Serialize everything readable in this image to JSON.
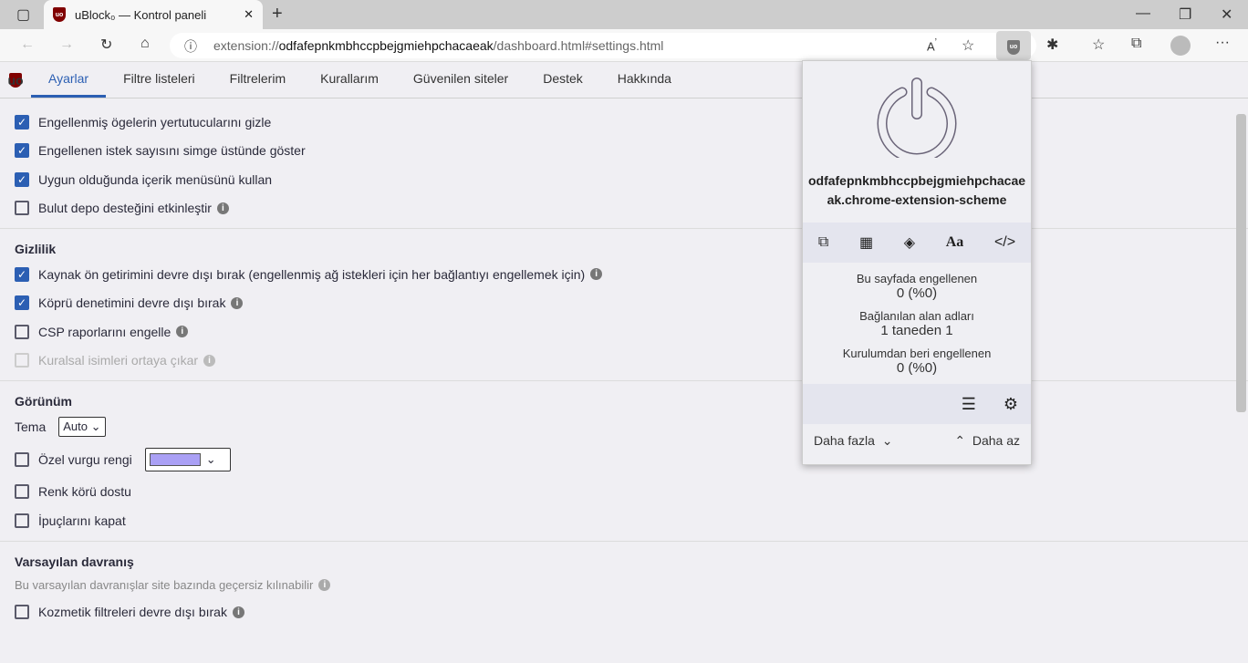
{
  "browser": {
    "tab_title": "uBlock₀ — Kontrol paneli",
    "url_prefix": "extension://",
    "url_host": "odfafepnkmbhccpbejgmiehpchacaeak",
    "url_path": "/dashboard.html#settings.html"
  },
  "nav": {
    "tabs": [
      "Ayarlar",
      "Filtre listeleri",
      "Filtrelerim",
      "Kurallarım",
      "Güvenilen siteler",
      "Destek",
      "Hakkında"
    ]
  },
  "general": [
    {
      "label": "Engellenmiş ögelerin yertutucularını gizle",
      "checked": true
    },
    {
      "label": "Engellenen istek sayısını simge üstünde göster",
      "checked": true
    },
    {
      "label": "Uygun olduğunda içerik menüsünü kullan",
      "checked": true
    },
    {
      "label": "Bulut depo desteğini etkinleştir",
      "checked": false
    }
  ],
  "privacy": {
    "title": "Gizlilik",
    "items": [
      {
        "label": "Kaynak ön getirimini devre dışı bırak (engellenmiş ağ istekleri için her bağlantıyı engellemek için)"
      },
      {
        "label": "Köprü denetimini devre dışı bırak"
      },
      {
        "label": "CSP raporlarını engelle"
      },
      {
        "label": "Kuralsal isimleri ortaya çıkar"
      }
    ]
  },
  "appearance": {
    "title": "Görünüm",
    "theme_label": "Tema",
    "theme_value": "Auto",
    "accent_label": "Özel vurgu rengi",
    "accent_color": "#aaa0f5",
    "colorblind": "Renk körü dostu",
    "tooltips": "İpuçlarını kapat"
  },
  "defaults": {
    "title": "Varsayılan davranış",
    "note": "Bu varsayılan davranışlar site bazında geçersiz kılınabilir",
    "cosmetic": "Kozmetik filtreleri devre dışı bırak"
  },
  "popup": {
    "host_line1": "odfafepnkmbhccpbejgmiehpchacae",
    "host_line2": "ak.chrome-extension-scheme",
    "blocked_page_label": "Bu sayfada engellenen",
    "blocked_page_value": "0 (%0)",
    "domains_label": "Bağlanılan alan adları",
    "domains_value": "1 taneden 1",
    "blocked_total_label": "Kurulumdan beri engellenen",
    "blocked_total_value": "0 (%0)",
    "more": "Daha fazla",
    "less": "Daha az"
  }
}
